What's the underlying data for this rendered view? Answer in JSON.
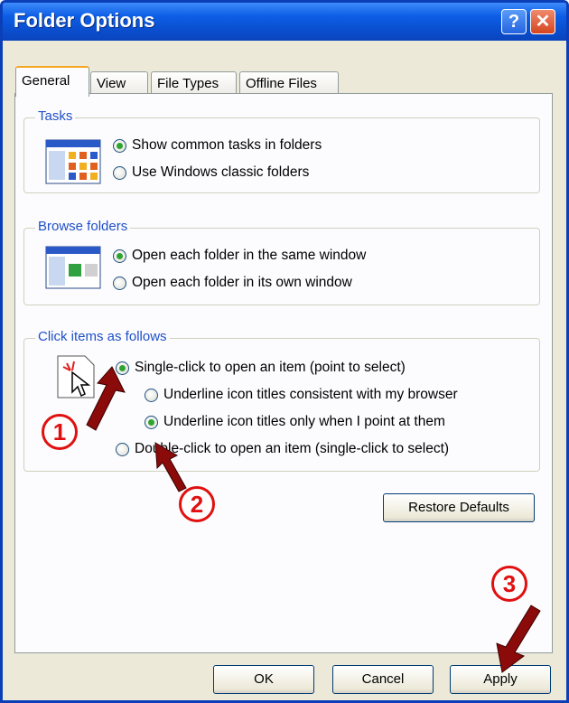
{
  "window": {
    "title": "Folder Options",
    "help_glyph": "?",
    "close_glyph": "✕"
  },
  "tabs": [
    {
      "label": "General",
      "active": true
    },
    {
      "label": "View",
      "active": false
    },
    {
      "label": "File Types",
      "active": false
    },
    {
      "label": "Offline Files",
      "active": false
    }
  ],
  "tasks": {
    "label": "Tasks",
    "options": [
      {
        "label": "Show common tasks in folders",
        "checked": true
      },
      {
        "label": "Use Windows classic folders",
        "checked": false
      }
    ]
  },
  "browse": {
    "label": "Browse folders",
    "options": [
      {
        "label": "Open each folder in the same window",
        "checked": true
      },
      {
        "label": "Open each folder in its own window",
        "checked": false
      }
    ]
  },
  "click": {
    "label": "Click items as follows",
    "single": "Single-click to open an item (point to select)",
    "underline_browser": "Underline icon titles consistent with my browser",
    "underline_point": "Underline icon titles only when I point at them",
    "double": "Double-click to open an item (single-click to select)"
  },
  "buttons": {
    "restore": "Restore Defaults",
    "ok": "OK",
    "cancel": "Cancel",
    "apply": "Apply"
  },
  "annotations": {
    "one": "1",
    "two": "2",
    "three": "3"
  },
  "colors": {
    "title_bar": "#0a4fd0",
    "group_label": "#1f50c8",
    "annotation": "#e01010",
    "checked_dot": "#2fa32f"
  }
}
